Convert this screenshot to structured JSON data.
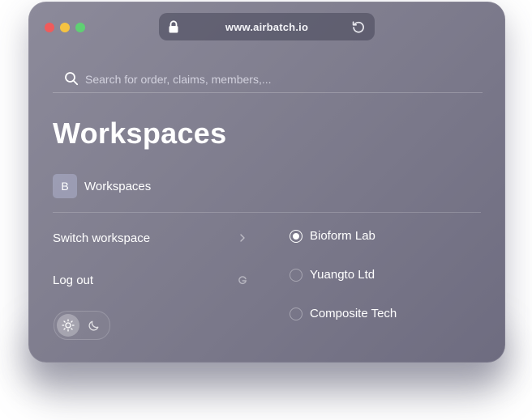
{
  "browser": {
    "url": "www.airbatch.io"
  },
  "search": {
    "placeholder": "Search for order, claims, members,..."
  },
  "page": {
    "title": "Workspaces"
  },
  "current_workspace": {
    "badge": "B",
    "label": "Workspaces"
  },
  "menu": {
    "switch_label": "Switch workspace",
    "logout_label": "Log out"
  },
  "theme": {
    "options": [
      "light",
      "dark"
    ],
    "selected": "light"
  },
  "workspaces": [
    {
      "name": "Bioform Lab",
      "selected": true
    },
    {
      "name": "Yuangto Ltd",
      "selected": false
    },
    {
      "name": "Composite Tech",
      "selected": false
    }
  ],
  "colors": {
    "window_bg": "#7f7d8e",
    "text": "#ffffff",
    "close": "#f05b5b",
    "minimize": "#f5c342",
    "maximize": "#5fd073"
  },
  "icons": {
    "url_left": "lock-icon",
    "url_right": "reload-icon",
    "search": "search-icon",
    "switch": "chevron-right-icon",
    "logout": "google-icon",
    "theme_light": "sun-icon",
    "theme_dark": "moon-icon"
  }
}
